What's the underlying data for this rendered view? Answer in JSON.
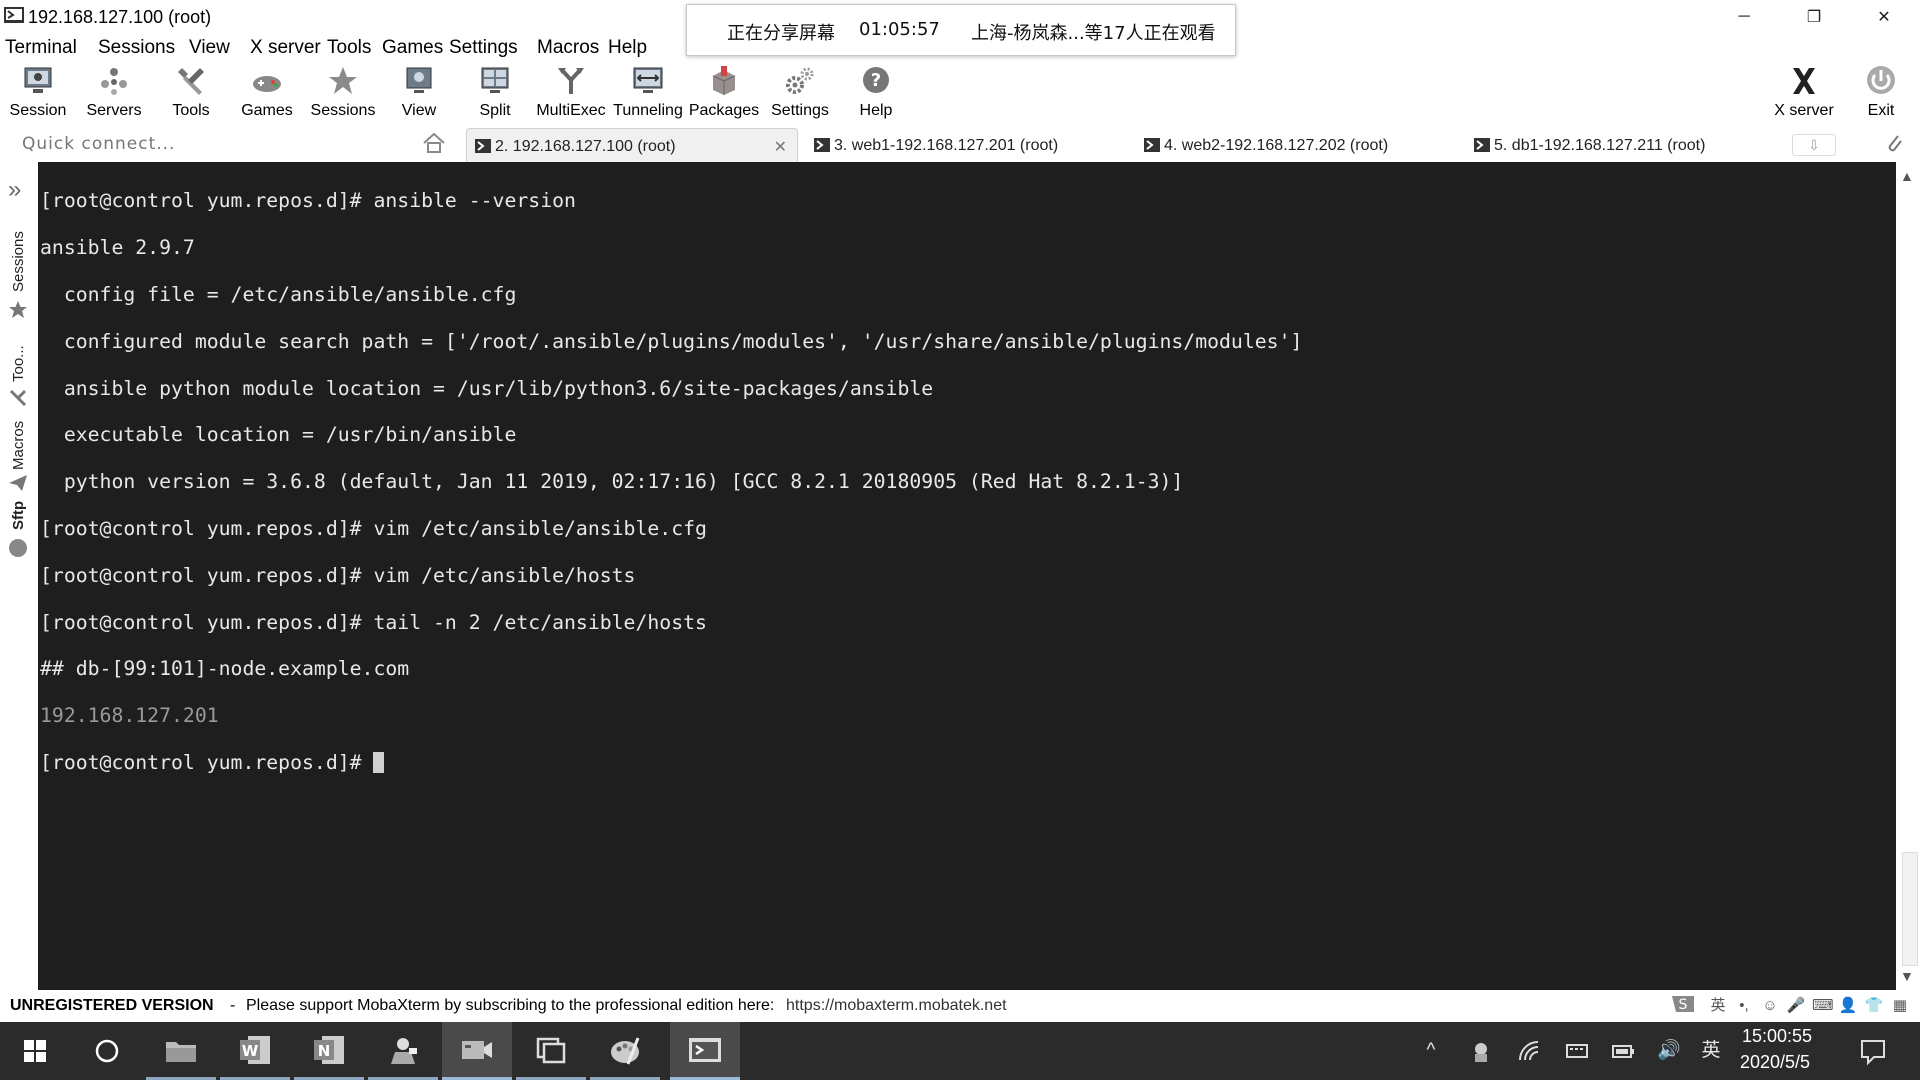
{
  "window": {
    "title": "192.168.127.100 (root)",
    "minimize_glyph": "─",
    "maximize_glyph": "❐",
    "close_glyph": "✕"
  },
  "share_overlay": {
    "status": "正在分享屏幕",
    "elapsed": "01:05:57",
    "viewers": "上海-杨岚森...等17人正在观看"
  },
  "menu": [
    "Terminal",
    "Sessions",
    "View",
    "X server",
    "Tools",
    "Games",
    "Settings",
    "Macros",
    "Help"
  ],
  "toolbar": {
    "buttons": [
      {
        "label": "Session",
        "icon": "monitor-icon"
      },
      {
        "label": "Servers",
        "icon": "servers-icon"
      },
      {
        "label": "Tools",
        "icon": "tools-icon"
      },
      {
        "label": "Games",
        "icon": "games-icon"
      },
      {
        "label": "Sessions",
        "icon": "star-icon"
      },
      {
        "label": "View",
        "icon": "view-icon"
      },
      {
        "label": "Split",
        "icon": "split-icon"
      },
      {
        "label": "MultiExec",
        "icon": "multiexec-icon"
      },
      {
        "label": "Tunneling",
        "icon": "tunneling-icon"
      },
      {
        "label": "Packages",
        "icon": "packages-icon"
      },
      {
        "label": "Settings",
        "icon": "gears-icon"
      },
      {
        "label": "Help",
        "icon": "help-icon"
      }
    ],
    "right_buttons": [
      {
        "label": "X server",
        "icon": "x-server-icon"
      },
      {
        "label": "Exit",
        "icon": "power-icon"
      }
    ]
  },
  "quick_connect": {
    "placeholder": "Quick connect..."
  },
  "tabs": [
    {
      "label": "2. 192.168.127.100 (root)",
      "active": true
    },
    {
      "label": "3. web1-192.168.127.201 (root)",
      "active": false
    },
    {
      "label": "4. web2-192.168.127.202 (root)",
      "active": false
    },
    {
      "label": "5. db1-192.168.127.211 (root)",
      "active": false
    }
  ],
  "tab_close_glyph": "✕",
  "tab_scroll_glyph": "⇩",
  "side_panel": {
    "expand_glyph": "»",
    "tabs": [
      "Sessions",
      "Too...",
      "Macros",
      "Sftp"
    ]
  },
  "terminal": {
    "lines": [
      "[root@control yum.repos.d]# ansible --version",
      "ansible 2.9.7",
      "  config file = /etc/ansible/ansible.cfg",
      "  configured module search path = ['/root/.ansible/plugins/modules', '/usr/share/ansible/plugins/modules']",
      "  ansible python module location = /usr/lib/python3.6/site-packages/ansible",
      "  executable location = /usr/bin/ansible",
      "  python version = 3.6.8 (default, Jan 11 2019, 02:17:16) [GCC 8.2.1 20180905 (Red Hat 8.2.1-3)]",
      "[root@control yum.repos.d]# vim /etc/ansible/ansible.cfg",
      "[root@control yum.repos.d]# vim /etc/ansible/hosts",
      "[root@control yum.repos.d]# tail -n 2 /etc/ansible/hosts",
      "## db-[99:101]-node.example.com",
      "192.168.127.201"
    ],
    "prompt": "[root@control yum.repos.d]# ",
    "background": "#1e1e1e",
    "foreground": "#e8e8e8"
  },
  "scrollbar": {
    "up_glyph": "▲",
    "down_glyph": "▼"
  },
  "status": {
    "unregistered": "UNREGISTERED VERSION",
    "separator": "-",
    "message": "Please support MobaXterm by subscribing to the professional edition here:",
    "link": "https://mobaxterm.mobatek.net"
  },
  "ime": {
    "lang": "英",
    "punct": "•,",
    "emoji": "☺",
    "mic": "🎤",
    "keyboard": "⌨",
    "user": "👤",
    "shirt": "👕",
    "grid": "▦"
  },
  "taskbar": {
    "apps": [
      "windows-start-icon",
      "cortana-search-icon",
      "file-explorer-icon",
      "word-icon",
      "onenote-icon",
      "app-icon",
      "video-icon",
      "task-view-icon",
      "paint-icon",
      "mobaxterm-icon"
    ],
    "tray": {
      "chevron": "^",
      "lang": "英",
      "volume": "🔊"
    },
    "time": "15:00:55",
    "date": "2020/5/5"
  }
}
